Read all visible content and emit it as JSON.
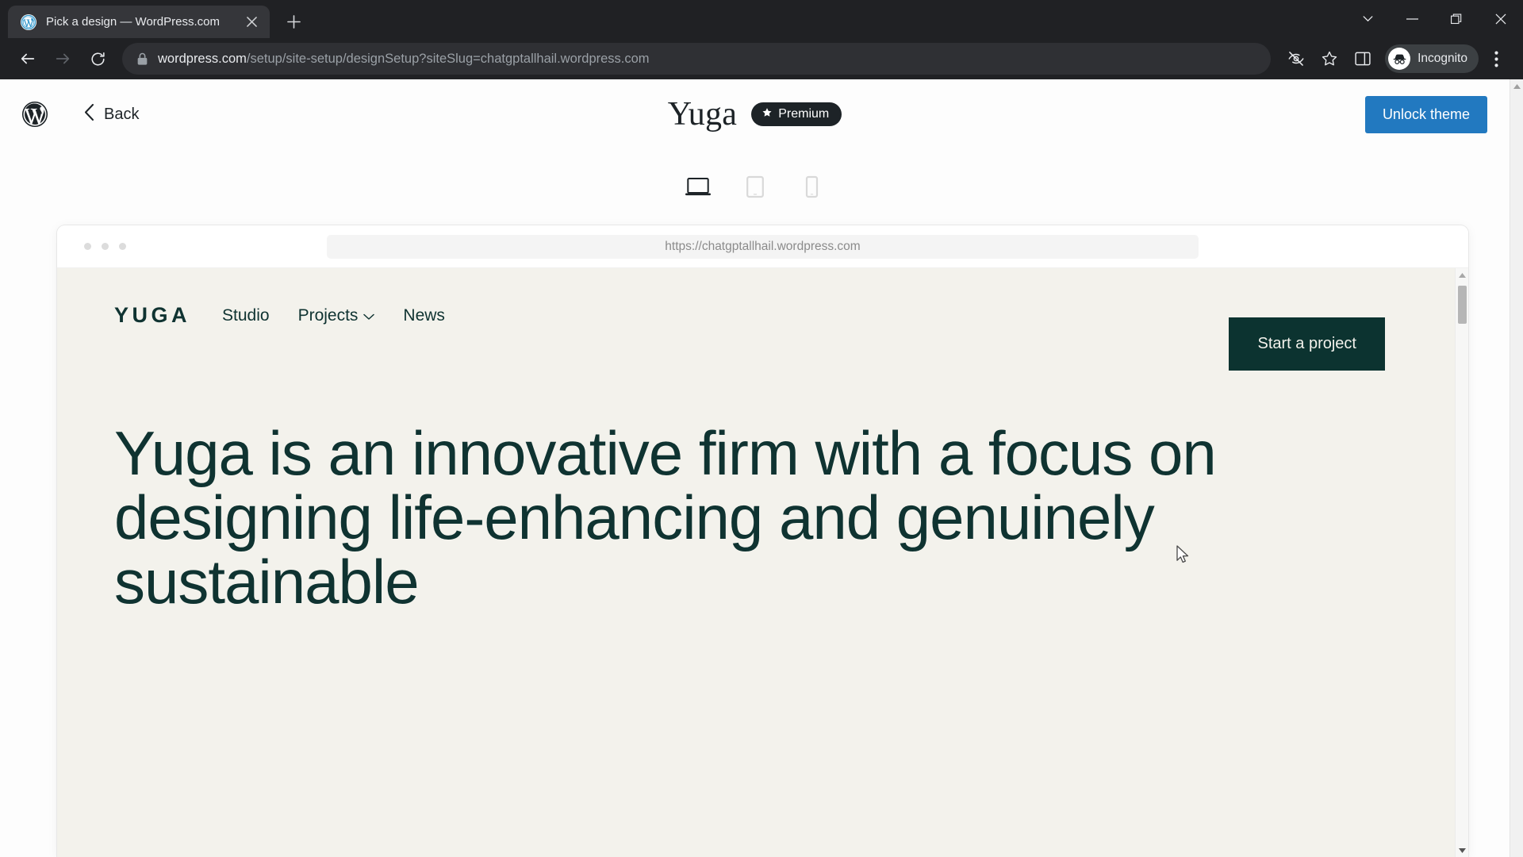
{
  "browser": {
    "tab": {
      "title": "Pick a design — WordPress.com",
      "favicon": "wordpress-icon",
      "close_label": "✕"
    },
    "new_tab_label": "+",
    "window_controls": {
      "tab_search": "⌄",
      "minimize": "—",
      "restore": "❐",
      "close": "✕"
    },
    "nav": {
      "back": "←",
      "forward": "→",
      "reload": "⟳"
    },
    "omnibox": {
      "url_domain": "wordpress.com",
      "url_path": "/setup/site-setup/designSetup?siteSlug=chatgptallhail.wordpress.com",
      "lock_icon": "lock-icon"
    },
    "toolbar_right": {
      "cookies_icon": "eye-off-icon",
      "bookmark_icon": "star-icon",
      "side_panel_icon": "side-panel-icon",
      "menu_icon": "three-dot-menu-icon",
      "profile_label": "Incognito",
      "profile_icon": "incognito-hat-icon"
    }
  },
  "wp_header": {
    "logo": "wordpress-logo",
    "back_label": "Back",
    "back_icon": "chevron-left-icon",
    "theme_name": "Yuga",
    "badge_label": "Premium",
    "badge_icon": "star-icon",
    "unlock_label": "Unlock theme",
    "unlock_color": "#2279c0"
  },
  "device_switcher": {
    "selected": "desktop",
    "options": [
      {
        "id": "desktop",
        "label": "Desktop",
        "icon": "laptop-icon",
        "active": true
      },
      {
        "id": "tablet",
        "label": "Tablet",
        "icon": "tablet-icon",
        "active": false
      },
      {
        "id": "mobile",
        "label": "Mobile",
        "icon": "phone-icon",
        "active": false
      }
    ]
  },
  "preview": {
    "address": "https://chatgptallhail.wordpress.com",
    "dots": 3,
    "site": {
      "logo": "YUGA",
      "nav": [
        {
          "label": "Studio",
          "has_dropdown": false
        },
        {
          "label": "Projects",
          "has_dropdown": true
        },
        {
          "label": "News",
          "has_dropdown": false
        }
      ],
      "cta_label": "Start a project",
      "hero_heading": "Yuga is an innovative firm with a focus on designing life-enhancing and genuinely sustainable",
      "colors": {
        "background": "#f3f2ec",
        "text": "#0f3331",
        "button_bg": "#0c3330",
        "button_text": "#f3f2ec"
      }
    }
  }
}
